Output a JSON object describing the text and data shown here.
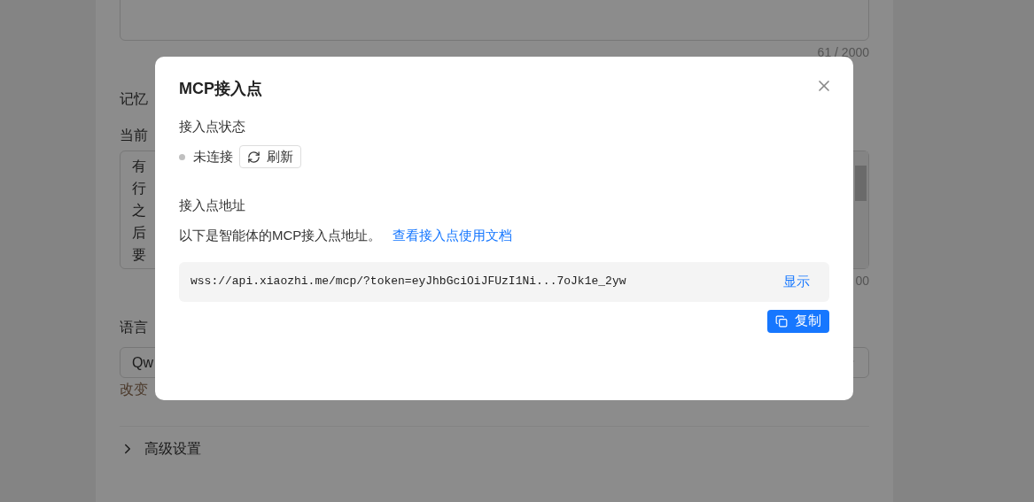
{
  "background": {
    "top_counter": "61 / 2000",
    "memory_label": "记忆",
    "current_label": "当前",
    "memory_lines": [
      "有",
      "行",
      "之",
      "后",
      "要"
    ],
    "memory_counter": "00",
    "model_label": "语言",
    "model_value": "Qw",
    "model_hint": "改变",
    "advanced": {
      "label": "高级设置",
      "expanded": false
    }
  },
  "dialog": {
    "title": "MCP接入点",
    "status_heading": "接入点状态",
    "status": {
      "text": "未连接",
      "color": "#c0c0c0"
    },
    "refresh_button": "刷新",
    "address_heading": "接入点地址",
    "description": "以下是智能体的MCP接入点地址。",
    "doc_link": "查看接入点使用文档",
    "address": "wss://api.xiaozhi.me/mcp/?token=eyJhbGciOiJFUzI1Ni...7oJk1e_2yw",
    "show_button": "显示",
    "copy_button": "复制"
  }
}
